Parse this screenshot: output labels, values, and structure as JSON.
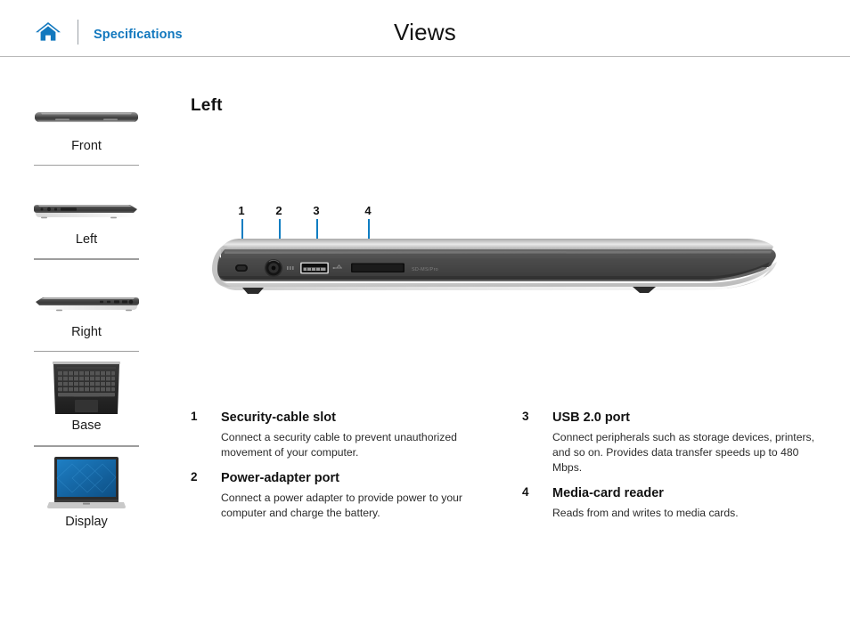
{
  "header": {
    "home_icon": "home-icon",
    "breadcrumb": "Specifications",
    "title": "Views"
  },
  "sidebar": {
    "items": [
      {
        "label": "Front",
        "thumb": "laptop-front-thumb"
      },
      {
        "label": "Left",
        "thumb": "laptop-left-thumb"
      },
      {
        "label": "Right",
        "thumb": "laptop-right-thumb"
      },
      {
        "label": "Base",
        "thumb": "laptop-base-thumb"
      },
      {
        "label": "Display",
        "thumb": "laptop-display-thumb"
      }
    ]
  },
  "main": {
    "section_title": "Left",
    "illustration": {
      "name": "laptop-left-side-view",
      "slot_label": "SD-MS/Pro",
      "callouts": [
        {
          "number": "1",
          "target": "security-cable-slot"
        },
        {
          "number": "2",
          "target": "power-adapter-port"
        },
        {
          "number": "3",
          "target": "usb-2-port"
        },
        {
          "number": "4",
          "target": "media-card-reader"
        }
      ]
    },
    "features_left": [
      {
        "number": "1",
        "name": "Security-cable slot",
        "desc": "Connect a security cable to prevent unauthorized movement of your computer."
      },
      {
        "number": "2",
        "name": "Power-adapter port",
        "desc": "Connect a power adapter to provide power to your computer and charge the battery."
      }
    ],
    "features_right": [
      {
        "number": "3",
        "name": "USB 2.0 port",
        "desc": "Connect peripherals such as storage devices, printers, and so on. Provides data transfer speeds up to 480 Mbps."
      },
      {
        "number": "4",
        "name": "Media-card reader",
        "desc": "Reads from and writes to media cards."
      }
    ]
  },
  "colors": {
    "accent_blue": "#1278be",
    "callout_blue": "#0f7dc2",
    "rule_gray": "#b9b9b9",
    "separator_gray": "#9d9d9d"
  }
}
